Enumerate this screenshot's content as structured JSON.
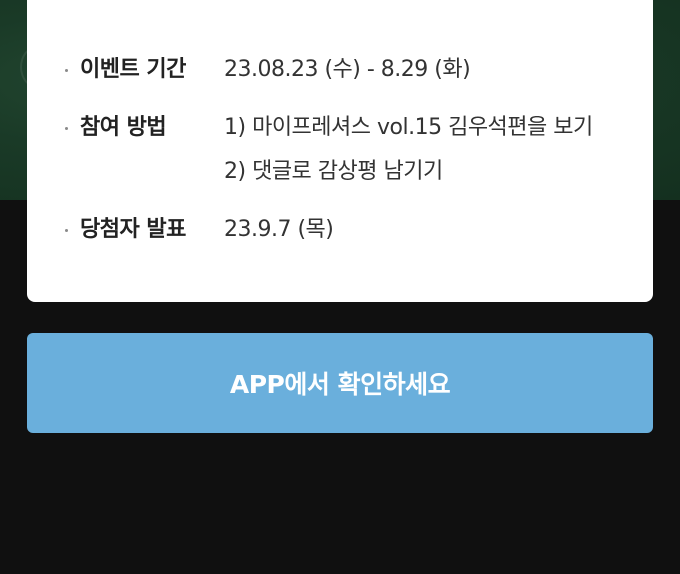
{
  "event_info": {
    "rows": [
      {
        "label": "이벤트 기간",
        "values": [
          "23.08.23 (수) - 8.29 (화)"
        ]
      },
      {
        "label": "참여 방법",
        "values": [
          "1) 마이프레셔스 vol.15 김우석편을 보기",
          "2) 댓글로 감상평 남기기"
        ]
      },
      {
        "label": "당첨자 발표",
        "values": [
          "23.9.7 (목)"
        ]
      }
    ]
  },
  "cta": {
    "label": "APP에서 확인하세요"
  },
  "colors": {
    "cta_bg": "#6aafdc",
    "card_bg": "#ffffff",
    "page_bg": "#101010",
    "banner_bg": "#1a3a27"
  }
}
